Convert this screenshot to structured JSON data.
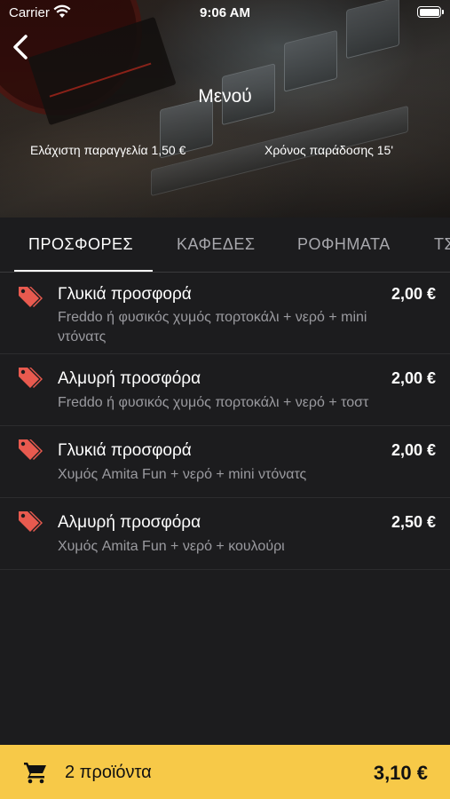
{
  "status_bar": {
    "carrier": "Carrier",
    "time": "9:06 AM"
  },
  "header": {
    "title": "Μενού",
    "min_order": "Ελάχιστη παραγγελία 1,50 €",
    "delivery_time": "Χρόνος παράδοσης 15'"
  },
  "tabs": [
    {
      "label": "ΠΡΟΣΦΟΡΕΣ",
      "active": true
    },
    {
      "label": "ΚΑΦΕΔΕΣ",
      "active": false
    },
    {
      "label": "ΡΟΦΗΜΑΤΑ",
      "active": false
    },
    {
      "label": "ΤΣ",
      "active": false
    }
  ],
  "items": [
    {
      "name": "Γλυκιά προσφορά",
      "price": "2,00 €",
      "description": "Freddo ή φυσικός χυμός πορτοκάλι + νερό + mini ντόνατς",
      "icon": "tag-icon"
    },
    {
      "name": "Αλμυρή προσφόρα",
      "price": "2,00 €",
      "description": "Freddo ή φυσικός χυμός πορτοκάλι + νερό + τοστ",
      "icon": "tag-icon"
    },
    {
      "name": "Γλυκιά προσφορά",
      "price": "2,00 €",
      "description": "Χυμός Amita Fun + νερό + mini ντόνατς",
      "icon": "tag-icon"
    },
    {
      "name": "Αλμυρή προσφόρα",
      "price": "2,50 €",
      "description": "Χυμός Amita Fun + νερό + κουλούρι",
      "icon": "tag-icon"
    }
  ],
  "cart": {
    "count_label": "2 προϊόντα",
    "total": "3,10 €",
    "icon": "cart-icon"
  },
  "colors": {
    "accent": "#f7c948",
    "tag": "#e85a4f",
    "background": "#1c1c1e"
  }
}
